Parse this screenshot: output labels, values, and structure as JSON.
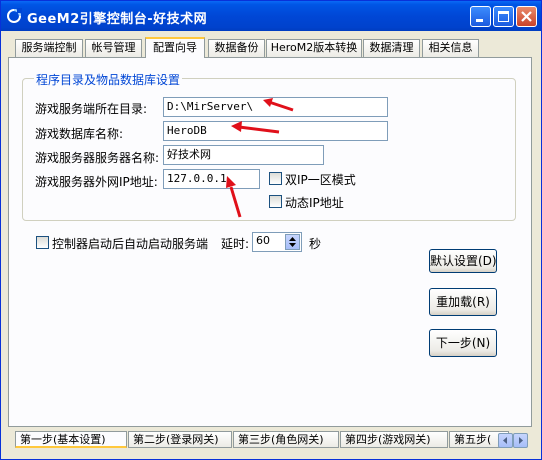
{
  "window": {
    "title": "GeeM2引擎控制台-好技术网"
  },
  "tabs": [
    {
      "label": "服务端控制"
    },
    {
      "label": "帐号管理"
    },
    {
      "label": "配置向导"
    },
    {
      "label": "数据备份"
    },
    {
      "label": "HeroM2版本转换"
    },
    {
      "label": "数据清理"
    },
    {
      "label": "相关信息"
    }
  ],
  "config": {
    "group_title": "程序目录及物品数据库设置",
    "server_dir_label": "游戏服务端所在目录:",
    "server_dir_value": "D:\\MirServer\\",
    "db_name_label": "游戏数据库名称:",
    "db_name_value": "HeroDB",
    "server_name_label": "游戏服务器服务器名称:",
    "server_name_value": "好技术网",
    "ip_label": "游戏服务器外网IP地址:",
    "ip_value": "127.0.0.1",
    "dual_ip_label": "双IP一区模式",
    "dynamic_ip_label": "动态IP地址",
    "autostart_label": "控制器启动后自动启动服务端",
    "delay_label": "延时:",
    "delay_value": "60",
    "delay_unit": "秒"
  },
  "buttons": {
    "default_settings": "默认设置(D)",
    "reload": "重加载(R)",
    "next": "下一步(N)"
  },
  "steps": [
    {
      "label": "第一步(基本设置)"
    },
    {
      "label": "第二步(登录网关)"
    },
    {
      "label": "第三步(角色网关)"
    },
    {
      "label": "第四步(游戏网关)"
    },
    {
      "label": "第五步("
    }
  ],
  "colors": {
    "titlebar": "#0054e3",
    "group_title": "#0046d5",
    "arrow": "#e0101a",
    "tab_highlight": "#ffc83c"
  }
}
